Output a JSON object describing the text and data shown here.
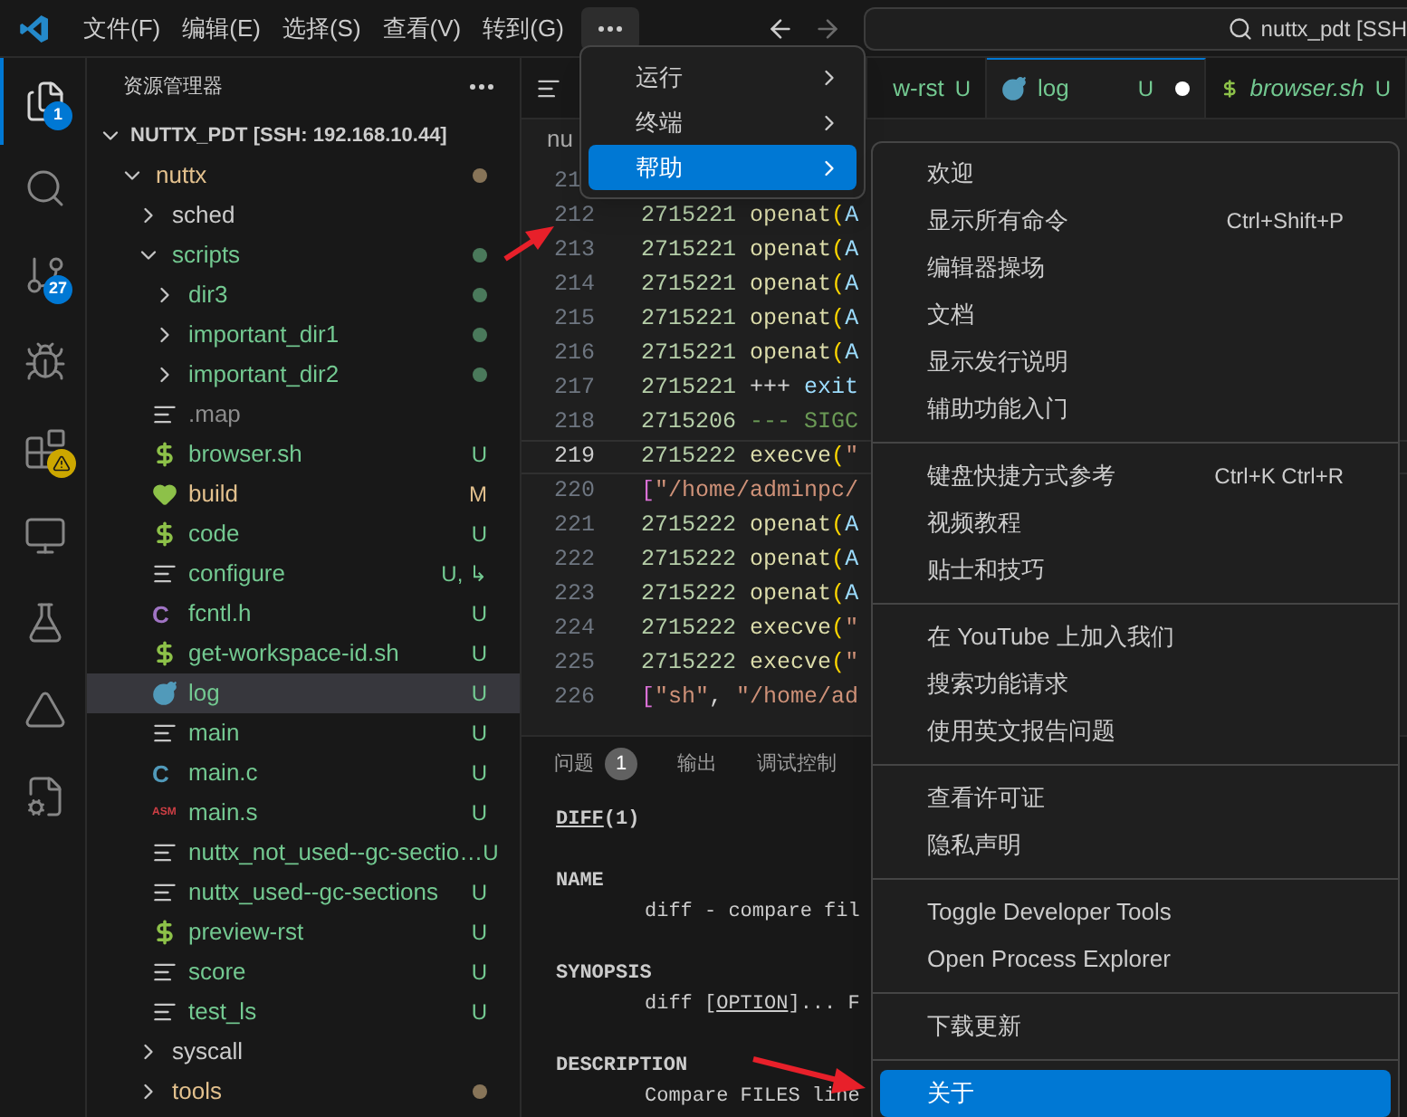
{
  "title_bar": {
    "menus": [
      "文件(F)",
      "编辑(E)",
      "选择(S)",
      "查看(V)",
      "转到(G)"
    ],
    "more_open": true,
    "search": "nuttx_pdt [SSH"
  },
  "activity_bar": [
    {
      "kind": "explorer",
      "selected": true,
      "badge": "1"
    },
    {
      "kind": "search",
      "selected": false
    },
    {
      "kind": "source-control",
      "selected": false,
      "badge": "27"
    },
    {
      "kind": "debug",
      "selected": false
    },
    {
      "kind": "extensions",
      "selected": false,
      "warning": true
    },
    {
      "kind": "remote",
      "selected": false
    },
    {
      "kind": "testing",
      "selected": false
    },
    {
      "kind": "triangle",
      "selected": false
    },
    {
      "kind": "file-gear",
      "selected": false
    }
  ],
  "explorer": {
    "title": "资源管理器",
    "root": {
      "label": "NUTTX_PDT [SSH: 192.168.10.44]",
      "expanded": true,
      "children": [
        {
          "label": "nuttx",
          "kind": "folder",
          "expanded": true,
          "selected": false,
          "color": "#e2c08d",
          "modified": true,
          "children": [
            {
              "label": "sched",
              "kind": "folder",
              "expanded": false,
              "selected": false,
              "color": "#cccccc",
              "modified": false
            },
            {
              "label": "scripts",
              "kind": "folder",
              "expanded": true,
              "selected": false,
              "color": "#73c991",
              "modified": true,
              "children": [
                {
                  "label": "dir3",
                  "kind": "folder",
                  "expanded": false,
                  "selected": false,
                  "color": "#73c991",
                  "modified": true
                },
                {
                  "label": "important_dir1",
                  "kind": "folder",
                  "expanded": false,
                  "selected": false,
                  "color": "#73c991",
                  "modified": true
                },
                {
                  "label": "important_dir2",
                  "kind": "folder",
                  "expanded": false,
                  "selected": false,
                  "color": "#73c991",
                  "modified": true
                },
                {
                  "label": ".map",
                  "kind": "lines",
                  "selected": false,
                  "color": "#8c8c8c"
                },
                {
                  "label": "browser.sh",
                  "kind": "dollar",
                  "selected": false,
                  "color": "#73c991",
                  "status": "U"
                },
                {
                  "label": "build",
                  "kind": "heart",
                  "selected": false,
                  "color": "#e2c08d",
                  "status": "M"
                },
                {
                  "label": "code",
                  "kind": "dollar",
                  "selected": false,
                  "color": "#73c991",
                  "status": "U"
                },
                {
                  "label": "configure",
                  "kind": "lines",
                  "selected": false,
                  "color": "#73c991",
                  "status": "U, ↳"
                },
                {
                  "label": "fcntl.h",
                  "kind": "c-header",
                  "glyph": "C",
                  "selected": false,
                  "color": "#73c991",
                  "status": "U"
                },
                {
                  "label": "get-workspace-id.sh",
                  "kind": "dollar",
                  "selected": false,
                  "color": "#73c991",
                  "status": "U"
                },
                {
                  "label": "log",
                  "kind": "log",
                  "selected": true,
                  "color": "#73c991",
                  "status": "U"
                },
                {
                  "label": "main",
                  "kind": "lines",
                  "selected": false,
                  "color": "#73c991",
                  "status": "U"
                },
                {
                  "label": "main.c",
                  "kind": "c",
                  "glyph": "C",
                  "selected": false,
                  "color": "#73c991",
                  "status": "U"
                },
                {
                  "label": "main.s",
                  "kind": "asm",
                  "glyph": "ASM",
                  "selected": false,
                  "color": "#73c991",
                  "status": "U"
                },
                {
                  "label": "nuttx_not_used--gc-sectio…",
                  "kind": "lines",
                  "selected": false,
                  "color": "#73c991",
                  "status": "U"
                },
                {
                  "label": "nuttx_used--gc-sections",
                  "kind": "lines",
                  "selected": false,
                  "color": "#73c991",
                  "status": "U"
                },
                {
                  "label": "preview-rst",
                  "kind": "dollar",
                  "selected": false,
                  "color": "#73c991",
                  "status": "U"
                },
                {
                  "label": "score",
                  "kind": "lines",
                  "selected": false,
                  "color": "#73c991",
                  "status": "U"
                },
                {
                  "label": "test_ls",
                  "kind": "lines",
                  "selected": false,
                  "color": "#73c991",
                  "status": "U"
                }
              ]
            },
            {
              "label": "syscall",
              "kind": "folder",
              "expanded": false,
              "selected": false,
              "color": "#cccccc",
              "modified": false
            },
            {
              "label": "tools",
              "kind": "folder",
              "expanded": false,
              "selected": false,
              "color": "#e2c08d",
              "modified": true
            }
          ]
        }
      ]
    }
  },
  "editor": {
    "tabs": [
      {
        "kind": "lines",
        "selected": false
      },
      {
        "label": "w-rst",
        "status": "U",
        "selected": false
      },
      {
        "kind": "log",
        "label": "log",
        "status": "U",
        "dirty": true,
        "selected": true
      },
      {
        "kind": "dollar",
        "label": "browser.sh",
        "status": "U",
        "preview": true,
        "selected": false
      }
    ],
    "breadcrumb": "nu",
    "lines": [
      {
        "number": "21"
      },
      {
        "number": "212",
        "pid": "2715221",
        "tokens": [
          {
            "kind": "func",
            "text": "openat"
          },
          {
            "kind": "paren",
            "text": "("
          },
          {
            "kind": "ident",
            "text": "A"
          }
        ]
      },
      {
        "number": "213",
        "pid": "2715221",
        "tokens": [
          {
            "kind": "func",
            "text": "openat"
          },
          {
            "kind": "paren",
            "text": "("
          },
          {
            "kind": "ident",
            "text": "A"
          }
        ]
      },
      {
        "number": "214",
        "pid": "2715221",
        "tokens": [
          {
            "kind": "func",
            "text": "openat"
          },
          {
            "kind": "paren",
            "text": "("
          },
          {
            "kind": "ident",
            "text": "A"
          }
        ]
      },
      {
        "number": "215",
        "pid": "2715221",
        "tokens": [
          {
            "kind": "func",
            "text": "openat"
          },
          {
            "kind": "paren",
            "text": "("
          },
          {
            "kind": "ident",
            "text": "A"
          }
        ]
      },
      {
        "number": "216",
        "pid": "2715221",
        "tokens": [
          {
            "kind": "func",
            "text": "openat"
          },
          {
            "kind": "paren",
            "text": "("
          },
          {
            "kind": "ident",
            "text": "A"
          }
        ]
      },
      {
        "number": "217",
        "pid": "2715221",
        "tokens": [
          {
            "kind": "op",
            "text": "+++ "
          },
          {
            "kind": "ident",
            "text": "exit"
          }
        ]
      },
      {
        "number": "218",
        "pid": "2715206",
        "tokens": [
          {
            "kind": "comment",
            "text": "--- SIGC"
          }
        ]
      },
      {
        "number": "219",
        "pid": "2715222",
        "current": true,
        "tokens": [
          {
            "kind": "func",
            "text": "execve"
          },
          {
            "kind": "paren",
            "text": "("
          },
          {
            "kind": "string",
            "text": "\""
          }
        ]
      },
      {
        "number": "220",
        "tokens": [
          {
            "kind": "bracket",
            "text": "["
          },
          {
            "kind": "string",
            "text": "\"/home/adminpc/"
          }
        ]
      },
      {
        "number": "221",
        "pid": "2715222",
        "tokens": [
          {
            "kind": "func",
            "text": "openat"
          },
          {
            "kind": "paren",
            "text": "("
          },
          {
            "kind": "ident",
            "text": "A"
          }
        ]
      },
      {
        "number": "222",
        "pid": "2715222",
        "tokens": [
          {
            "kind": "func",
            "text": "openat"
          },
          {
            "kind": "paren",
            "text": "("
          },
          {
            "kind": "ident",
            "text": "A"
          }
        ]
      },
      {
        "number": "223",
        "pid": "2715222",
        "tokens": [
          {
            "kind": "func",
            "text": "openat"
          },
          {
            "kind": "paren",
            "text": "("
          },
          {
            "kind": "ident",
            "text": "A"
          }
        ]
      },
      {
        "number": "224",
        "pid": "2715222",
        "tokens": [
          {
            "kind": "func",
            "text": "execve"
          },
          {
            "kind": "paren",
            "text": "("
          },
          {
            "kind": "string",
            "text": "\""
          }
        ]
      },
      {
        "number": "225",
        "pid": "2715222",
        "tokens": [
          {
            "kind": "func",
            "text": "execve"
          },
          {
            "kind": "paren",
            "text": "("
          },
          {
            "kind": "string",
            "text": "\""
          }
        ]
      },
      {
        "number": "226",
        "tokens": [
          {
            "kind": "bracket",
            "text": "["
          },
          {
            "kind": "string",
            "text": "\"sh\""
          },
          {
            "kind": "plain",
            "text": ", "
          },
          {
            "kind": "string",
            "text": "\"/home/ad"
          }
        ]
      }
    ]
  },
  "panel": {
    "tabs": [
      {
        "label": "问题",
        "badge": "1",
        "selected": false
      },
      {
        "label": "输出",
        "selected": false
      },
      {
        "label": "调试控制",
        "selected": false
      }
    ],
    "man": [
      {
        "kind": "title",
        "parts": [
          {
            "text": "DIFF",
            "underline": true
          },
          {
            "text": "(1)",
            "underline": false
          }
        ]
      },
      {
        "kind": "heading",
        "parts": [
          {
            "text": "NAME",
            "underline": false
          }
        ]
      },
      {
        "kind": "body",
        "parts": [
          {
            "text": "diff - compare fil",
            "underline": false
          }
        ]
      },
      {
        "kind": "heading",
        "parts": [
          {
            "text": "SYNOPSIS",
            "underline": false
          }
        ]
      },
      {
        "kind": "body",
        "parts": [
          {
            "text": "diff [",
            "underline": false
          },
          {
            "text": "OPTION",
            "underline": true
          },
          {
            "text": "]... F",
            "underline": false
          }
        ]
      },
      {
        "kind": "heading",
        "parts": [
          {
            "text": "DESCRIPTION",
            "underline": false
          }
        ]
      },
      {
        "kind": "body",
        "parts": [
          {
            "text": "Compare FILES line",
            "underline": false
          }
        ]
      }
    ]
  },
  "menu": [
    {
      "label": "运行",
      "selected": false
    },
    {
      "label": "终端",
      "selected": false
    },
    {
      "label": "帮助",
      "selected": true
    }
  ],
  "submenu": [
    [
      {
        "label": "欢迎",
        "selected": false
      },
      {
        "label": "显示所有命令",
        "shortcut": "Ctrl+Shift+P",
        "selected": false
      },
      {
        "label": "编辑器操场",
        "selected": false
      },
      {
        "label": "文档",
        "selected": false
      },
      {
        "label": "显示发行说明",
        "selected": false
      },
      {
        "label": "辅助功能入门",
        "selected": false
      }
    ],
    [
      {
        "label": "键盘快捷方式参考",
        "shortcut": "Ctrl+K Ctrl+R",
        "selected": false
      },
      {
        "label": "视频教程",
        "selected": false
      },
      {
        "label": "贴士和技巧",
        "selected": false
      }
    ],
    [
      {
        "label": "在 YouTube 上加入我们",
        "selected": false
      },
      {
        "label": "搜索功能请求",
        "selected": false
      },
      {
        "label": "使用英文报告问题",
        "selected": false
      }
    ],
    [
      {
        "label": "查看许可证",
        "selected": false
      },
      {
        "label": "隐私声明",
        "selected": false
      }
    ],
    [
      {
        "label": "Toggle Developer Tools",
        "selected": false
      },
      {
        "label": "Open Process Explorer",
        "selected": false
      }
    ],
    [
      {
        "label": "下载更新",
        "selected": false
      }
    ],
    [
      {
        "label": "关于",
        "selected": true
      }
    ]
  ]
}
